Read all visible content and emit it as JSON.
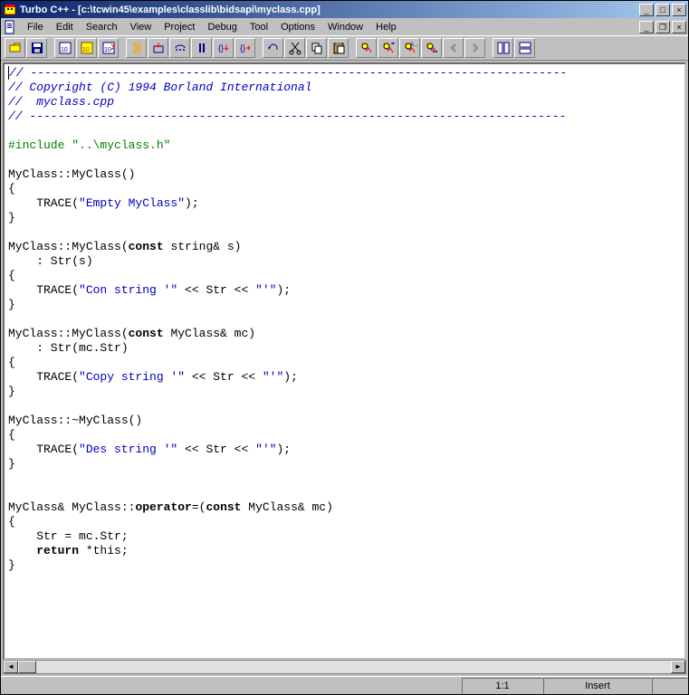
{
  "window": {
    "title": "Turbo C++ - [c:\\tcwin45\\examples\\classlib\\bidsapi\\myclass.cpp]"
  },
  "menu": {
    "file": "File",
    "edit": "Edit",
    "search": "Search",
    "view": "View",
    "project": "Project",
    "debug": "Debug",
    "tool": "Tool",
    "options": "Options",
    "window": "Window",
    "help": "Help"
  },
  "code": {
    "dashline1": "// ----------------------------------------------------------------------------",
    "copyright": "// Copyright (C) 1994 Borland International",
    "filename": "//  myclass.cpp",
    "dashline2": "// ----------------------------------------------------------------------------",
    "include_kw": "#include ",
    "include_path": "\"..\\myclass.h\"",
    "ctor0_sig": "MyClass::MyClass()",
    "ctor0_trace_call": "    TRACE(",
    "ctor0_trace_str": "\"Empty MyClass\"",
    "ctor0_trace_end": ");",
    "ctor1_sig_pre": "MyClass::MyClass(",
    "ctor1_const": "const",
    "ctor1_sig_post": " string& s)",
    "ctor1_init": "    : Str(s)",
    "ctor1_trace_call": "    TRACE(",
    "ctor1_trace_s1": "\"Con string '\"",
    "ctor1_trace_mid": " << Str << ",
    "ctor1_trace_s2": "\"'\"",
    "ctor1_trace_end": ");",
    "cctor_sig_pre": "MyClass::MyClass(",
    "cctor_const": "const",
    "cctor_sig_post": " MyClass& mc)",
    "cctor_init": "    : Str(mc.Str)",
    "cctor_trace_call": "    TRACE(",
    "cctor_trace_s1": "\"Copy string '\"",
    "cctor_trace_mid": " << Str << ",
    "cctor_trace_s2": "\"'\"",
    "cctor_trace_end": ");",
    "dtor_sig": "MyClass::~MyClass()",
    "dtor_trace_call": "    TRACE(",
    "dtor_trace_s1": "\"Des string '\"",
    "dtor_trace_mid": " << Str << ",
    "dtor_trace_s2": "\"'\"",
    "dtor_trace_end": ");",
    "opeq_pre": "MyClass& MyClass::",
    "opeq_kw": "operator",
    "opeq_mid": "=(",
    "opeq_const": "const",
    "opeq_post": " MyClass& mc)",
    "opeq_body1": "    Str = mc.Str;",
    "opeq_ret_indent": "    ",
    "opeq_ret_kw": "return",
    "opeq_ret_rest": " *this;",
    "lbrace": "{",
    "rbrace": "}"
  },
  "status": {
    "pos": "1:1",
    "mode": "Insert"
  }
}
